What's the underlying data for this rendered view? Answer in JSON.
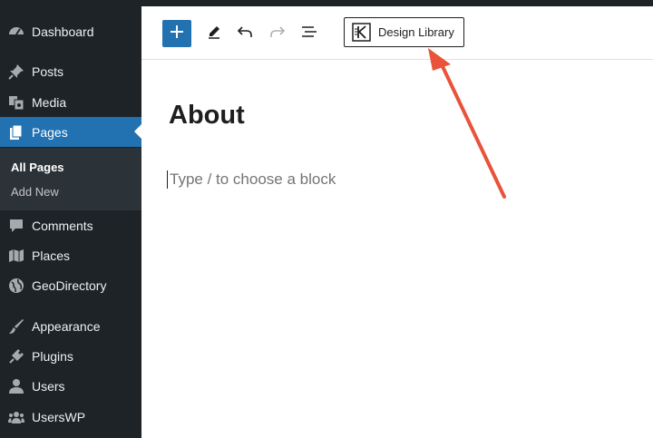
{
  "sidebar": {
    "items": [
      {
        "label": "Dashboard",
        "icon": "dashboard-icon"
      },
      {
        "label": "Posts",
        "icon": "pin-icon"
      },
      {
        "label": "Media",
        "icon": "media-icon"
      },
      {
        "label": "Pages",
        "icon": "pages-icon",
        "active": true
      },
      {
        "label": "Comments",
        "icon": "comment-icon"
      },
      {
        "label": "Places",
        "icon": "map-icon"
      },
      {
        "label": "GeoDirectory",
        "icon": "globe-icon"
      },
      {
        "label": "Appearance",
        "icon": "brush-icon"
      },
      {
        "label": "Plugins",
        "icon": "plugin-icon"
      },
      {
        "label": "Users",
        "icon": "user-icon"
      },
      {
        "label": "UsersWP",
        "icon": "users-group-icon"
      }
    ],
    "submenu": [
      {
        "label": "All Pages",
        "current": true
      },
      {
        "label": "Add New"
      }
    ]
  },
  "toolbar": {
    "design_library_label": "Design Library"
  },
  "editor": {
    "title": "About",
    "placeholder": "Type / to choose a block"
  },
  "colors": {
    "sidebar_bg": "#1d2327",
    "active_bg": "#2271b1",
    "arrow": "#e8533a"
  }
}
